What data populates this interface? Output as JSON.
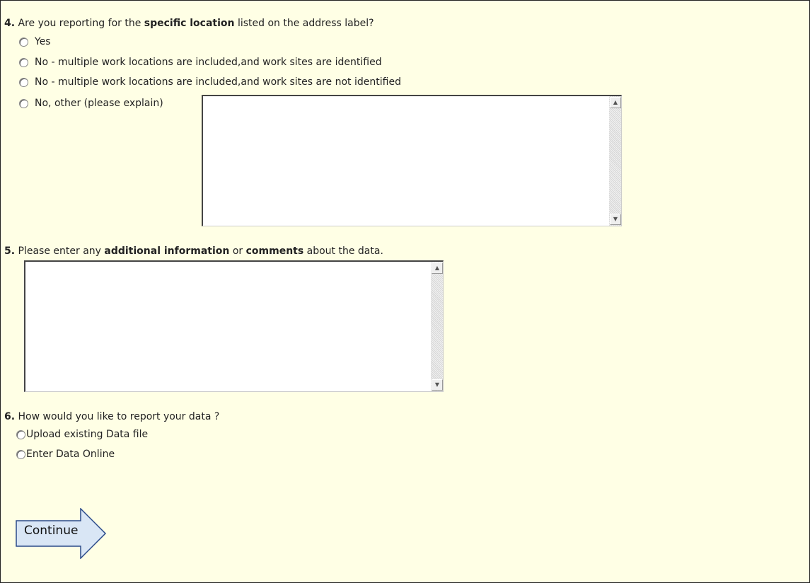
{
  "q4": {
    "number": "4.",
    "text_before": " Are you reporting for the ",
    "bold": "specific location",
    "text_after": " listed on the address label?",
    "options": [
      "Yes",
      "No - multiple work locations are included,and work sites are identified",
      "No - multiple work locations are included,and work sites are not identified",
      "No, other (please explain)"
    ],
    "explain_value": ""
  },
  "q5": {
    "number": "5.",
    "text_before": " Please enter any ",
    "bold1": "additional information",
    "mid": " or ",
    "bold2": "comments",
    "text_after": " about the data.",
    "comments_value": ""
  },
  "q6": {
    "number": "6.",
    "text": " How would you like to report your data ?",
    "options": [
      "Upload existing Data file",
      "Enter Data Online"
    ]
  },
  "continue_label": "Continue",
  "colors": {
    "panel_bg": "#ffffe5",
    "arrow_fill": "#d9e6f5",
    "arrow_stroke": "#2a4a8a"
  },
  "icons": {
    "scroll_up": "up-arrow-icon",
    "scroll_down": "down-arrow-icon",
    "continue": "right-arrow-icon"
  }
}
